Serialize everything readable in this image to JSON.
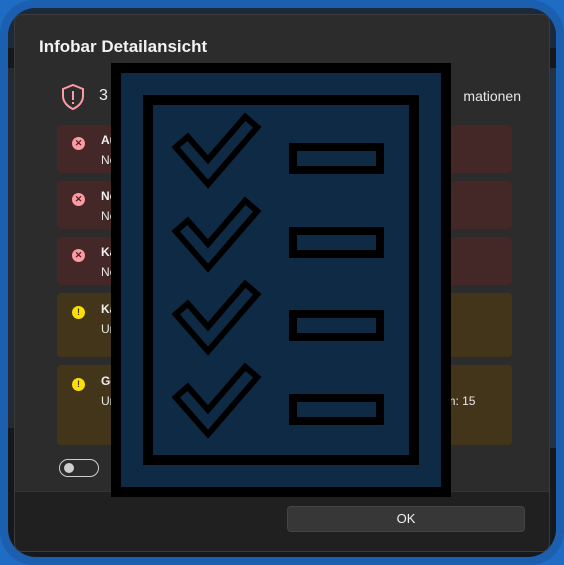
{
  "dialog": {
    "title": "Infobar Detailansicht",
    "summary_count": "3",
    "summary_suffix": "mationen",
    "ok_label": "OK",
    "toggle_label": "I"
  },
  "messages": [
    {
      "severity": "error",
      "icon": "error-x-icon",
      "title": "Au     yp",
      "severity_label": "Error",
      "body": "Ne       ensp      t der E"
    },
    {
      "severity": "error",
      "icon": "error-x-icon",
      "title": "Ne     Q",
      "severity_label": "Error",
      "body": "Ne     enspricht ni      er EN81:20!"
    },
    {
      "severity": "error",
      "icon": "error-x-icon",
      "title": "Ka     grund",
      "severity_label": "Error",
      "body": "Ne       enspricht nicht der EN81:20!"
    },
    {
      "severity": "warning",
      "icon": "warning-exclamation-icon",
      "title": "Ka     breite",
      "severity_label": "W",
      "body": "Un    ied   e für >Ka                 Wer      fikation: 11      ert Car      eProgram: 1,1"
    },
    {
      "severity": "warning",
      "icon": "warning-exclamation-icon",
      "title": "Ge     ndigkeitsbe          er",
      "severity_label": "Warning",
      "body": "Un    iedli       ur >G            begr      Wert Sp          200, FA, e              ekt      ückst.) | W         FrameP      ram: 15"
    }
  ],
  "colors": {
    "frame": "#1b5fae",
    "dialog_bg": "#2c2c2c",
    "error_bg": "#442727",
    "warning_bg": "#433519",
    "overlay_fill": "#0f2a45"
  },
  "overlay": {
    "icon": "checklist-clipboard-icon"
  }
}
